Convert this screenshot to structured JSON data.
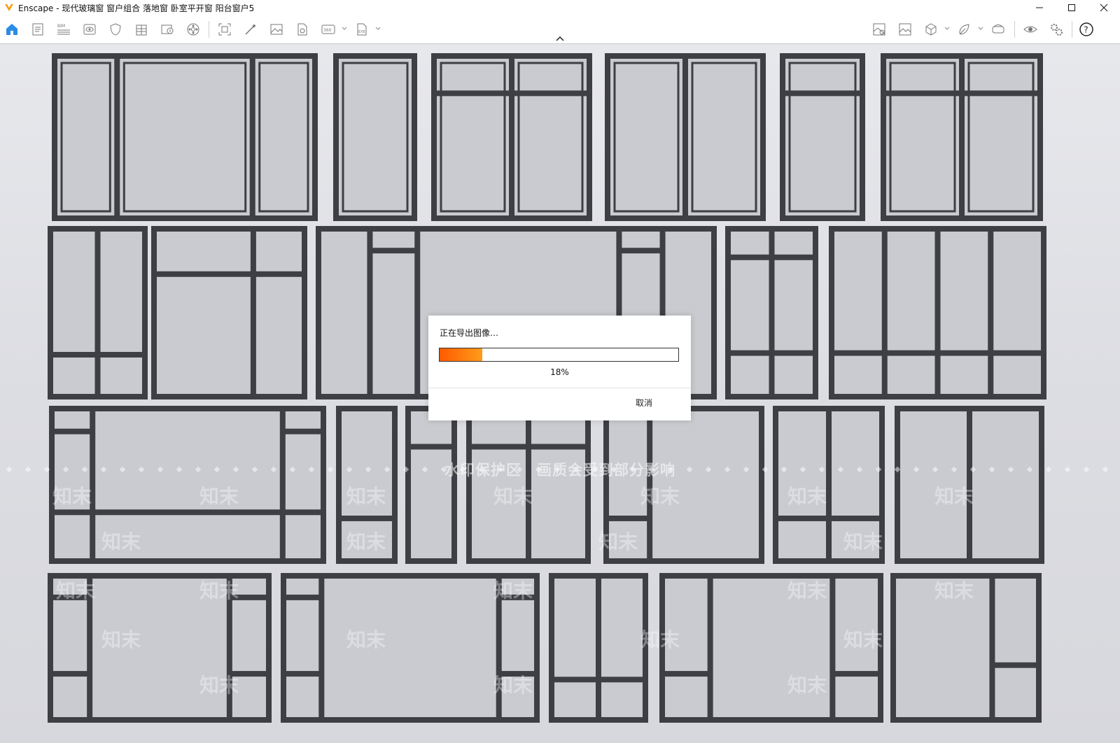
{
  "window": {
    "app_name": "Enscape",
    "title": "Enscape - 现代玻璃窗 窗户组合 落地窗 卧室平开窗 阳台窗户5",
    "minimize_glyph": "—",
    "maximize_glyph": "☐",
    "close_glyph": "✕"
  },
  "toolbar": {
    "left_icons": [
      "home-icon",
      "notes-icon",
      "bim-icon",
      "view-icon",
      "shield-icon",
      "building-icon",
      "export-image-icon",
      "settings-wheel-icon",
      "frame-icon",
      "magic-wand-icon",
      "picture-icon",
      "document-icon",
      "panorama-360-icon",
      "exe-export-icon"
    ],
    "right_icons": [
      "material-icon",
      "image-export-icon",
      "cube-icon",
      "asset-library-icon",
      "vr-headset-icon",
      "eye-icon",
      "settings-gears-icon",
      "help-icon"
    ],
    "help_glyph": "?"
  },
  "watermark": {
    "banner_text": "水印保护区　画质会受到部分影响",
    "repeat_text": "知末"
  },
  "export_dialog": {
    "title": "正在导出图像…",
    "progress": 0.18,
    "progress_label": "18%",
    "cancel_label": "取消"
  }
}
